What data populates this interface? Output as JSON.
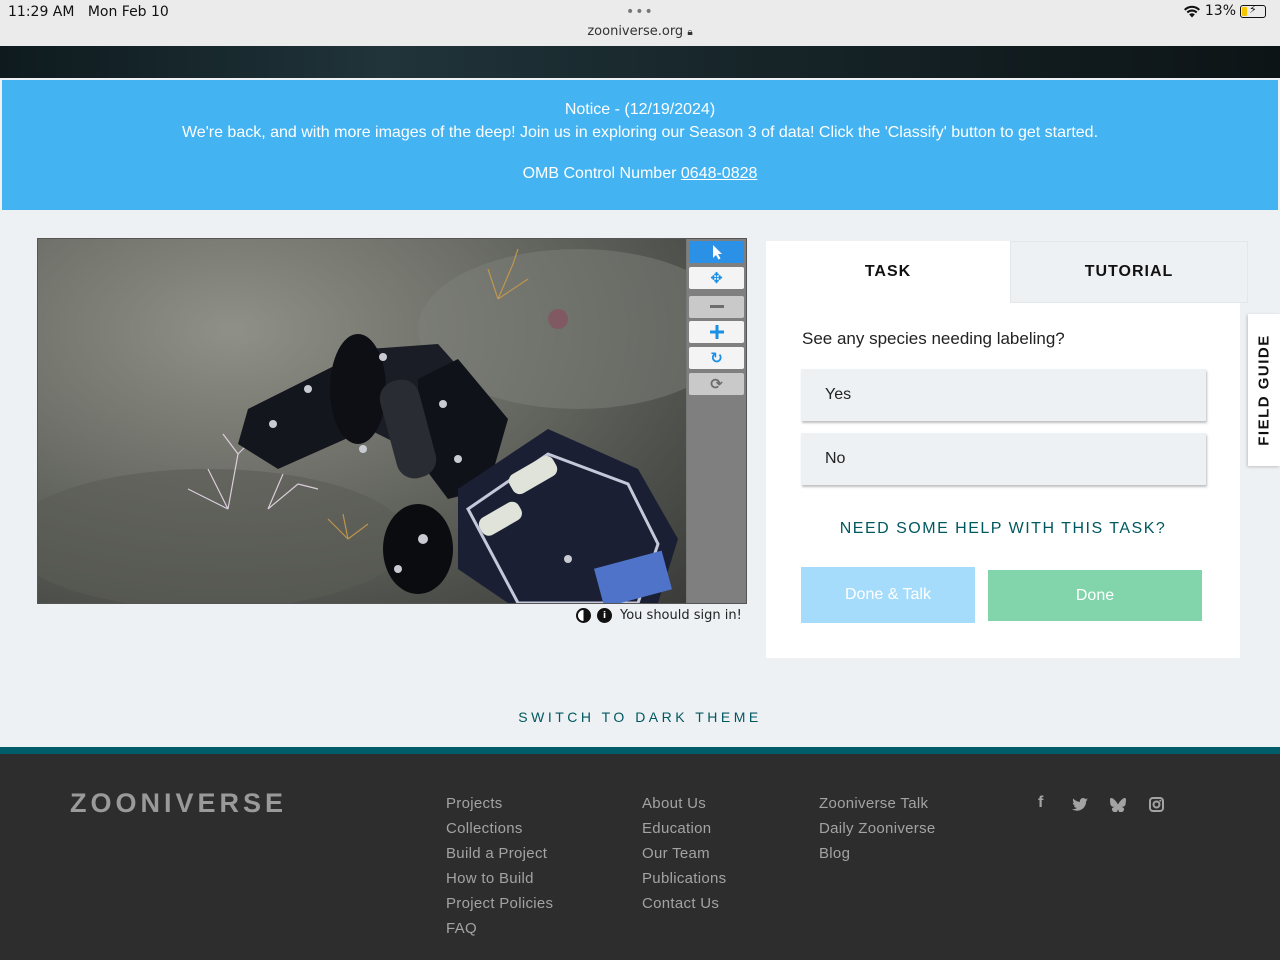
{
  "status_bar": {
    "time": "11:29 AM",
    "date": "Mon Feb 10",
    "url": "zooniverse.org",
    "battery": "13%"
  },
  "notice": {
    "title": "Notice - (12/19/2024)",
    "message": "We're back, and with more images of the deep! Join us in exploring our Season 3 of data! Click the 'Classify' button to get started.",
    "omb_label": "OMB Control Number",
    "omb_number": "0648-0828"
  },
  "viewer": {
    "tools": [
      "pointer-icon",
      "move-icon",
      "zoom-out-icon",
      "zoom-in-icon",
      "rotate-icon",
      "reset-icon"
    ],
    "sign_in_text": "You should sign in!"
  },
  "task": {
    "tab_task": "TASK",
    "tab_tutorial": "TUTORIAL",
    "question": "See any species needing labeling?",
    "answers": [
      "Yes",
      "No"
    ],
    "help": "NEED SOME HELP WITH THIS TASK?",
    "done_talk": "Done & Talk",
    "done": "Done",
    "field_guide": "FIELD GUIDE"
  },
  "theme_toggle": "SWITCH TO DARK THEME",
  "footer": {
    "logo": "ZOONIVERSE",
    "col1": [
      "Projects",
      "Collections",
      "Build a Project",
      "How to Build",
      "Project Policies",
      "FAQ"
    ],
    "col2": [
      "About Us",
      "Education",
      "Our Team",
      "Publications",
      "Contact Us"
    ],
    "col3": [
      "Zooniverse Talk",
      "Daily Zooniverse",
      "Blog"
    ],
    "social": [
      "facebook-icon",
      "twitter-icon",
      "bluesky-icon",
      "instagram-icon"
    ]
  },
  "colors": {
    "notice_bg": "#43b3f2",
    "teal": "#00585f",
    "done_talk": "#a6dcfb",
    "done": "#82d4ab",
    "footer_bg": "#2d2d2d"
  }
}
